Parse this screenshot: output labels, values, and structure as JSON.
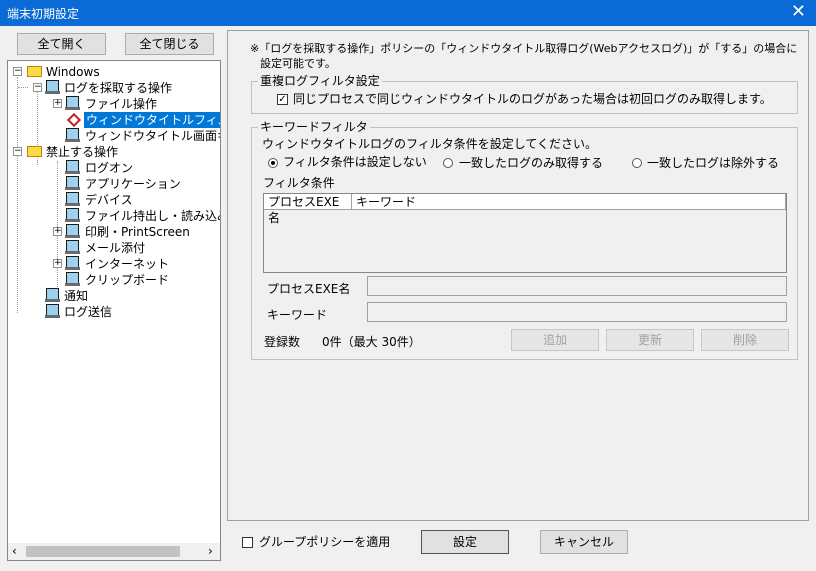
{
  "window": {
    "title": "端末初期設定",
    "close_label": "✕"
  },
  "left": {
    "expand_all": "全て開く",
    "collapse_all": "全て閉じる",
    "tree": {
      "root": "Windows",
      "log_ops": "ログを採取する操作",
      "file_ops": "ファイル操作",
      "window_title_filter": "ウィンドウタイトルフィルタ",
      "window_title_screen": "ウィンドウタイトル画面キャ",
      "prohibited_ops": "禁止する操作",
      "logon": "ログオン",
      "application": "アプリケーション",
      "device": "デバイス",
      "file_io": "ファイル持出し・読み込み",
      "print": "印刷・PrintScreen",
      "mail": "メール添付",
      "internet": "インターネット",
      "clipboard": "クリップボード",
      "notify": "通知",
      "log_send": "ログ送信"
    }
  },
  "main": {
    "note_line1": "※「ログを採取する操作」ポリシーの「ウィンドウタイトル取得ログ(Webアクセスログ)」が「する」の場合に",
    "note_line2": "設定可能です。",
    "dup_group": {
      "title": "重複ログフィルタ設定",
      "checkbox_label": "同じプロセスで同じウィンドウタイトルのログがあった場合は初回ログのみ取得します。",
      "checked": true
    },
    "keyword_group": {
      "title": "キーワードフィルタ",
      "desc": "ウィンドウタイトルログのフィルタ条件を設定してください。",
      "radio_none": "フィルタ条件は設定しない",
      "radio_match": "一致したログのみ取得する",
      "radio_exclude": "一致したログは除外する",
      "selected": "none",
      "filter_label": "フィルタ条件",
      "columns": [
        "プロセスEXE名",
        "キーワード"
      ],
      "exe_label": "プロセスEXE名",
      "keyword_label": "キーワード",
      "count_label": "登録数",
      "count_value": "0件（最大  30件）",
      "add_button": "追加",
      "update_button": "更新",
      "delete_button": "削除"
    }
  },
  "footer": {
    "group_policy_label": "グループポリシーを適用",
    "set_button": "設定",
    "cancel_button": "キャンセル"
  }
}
